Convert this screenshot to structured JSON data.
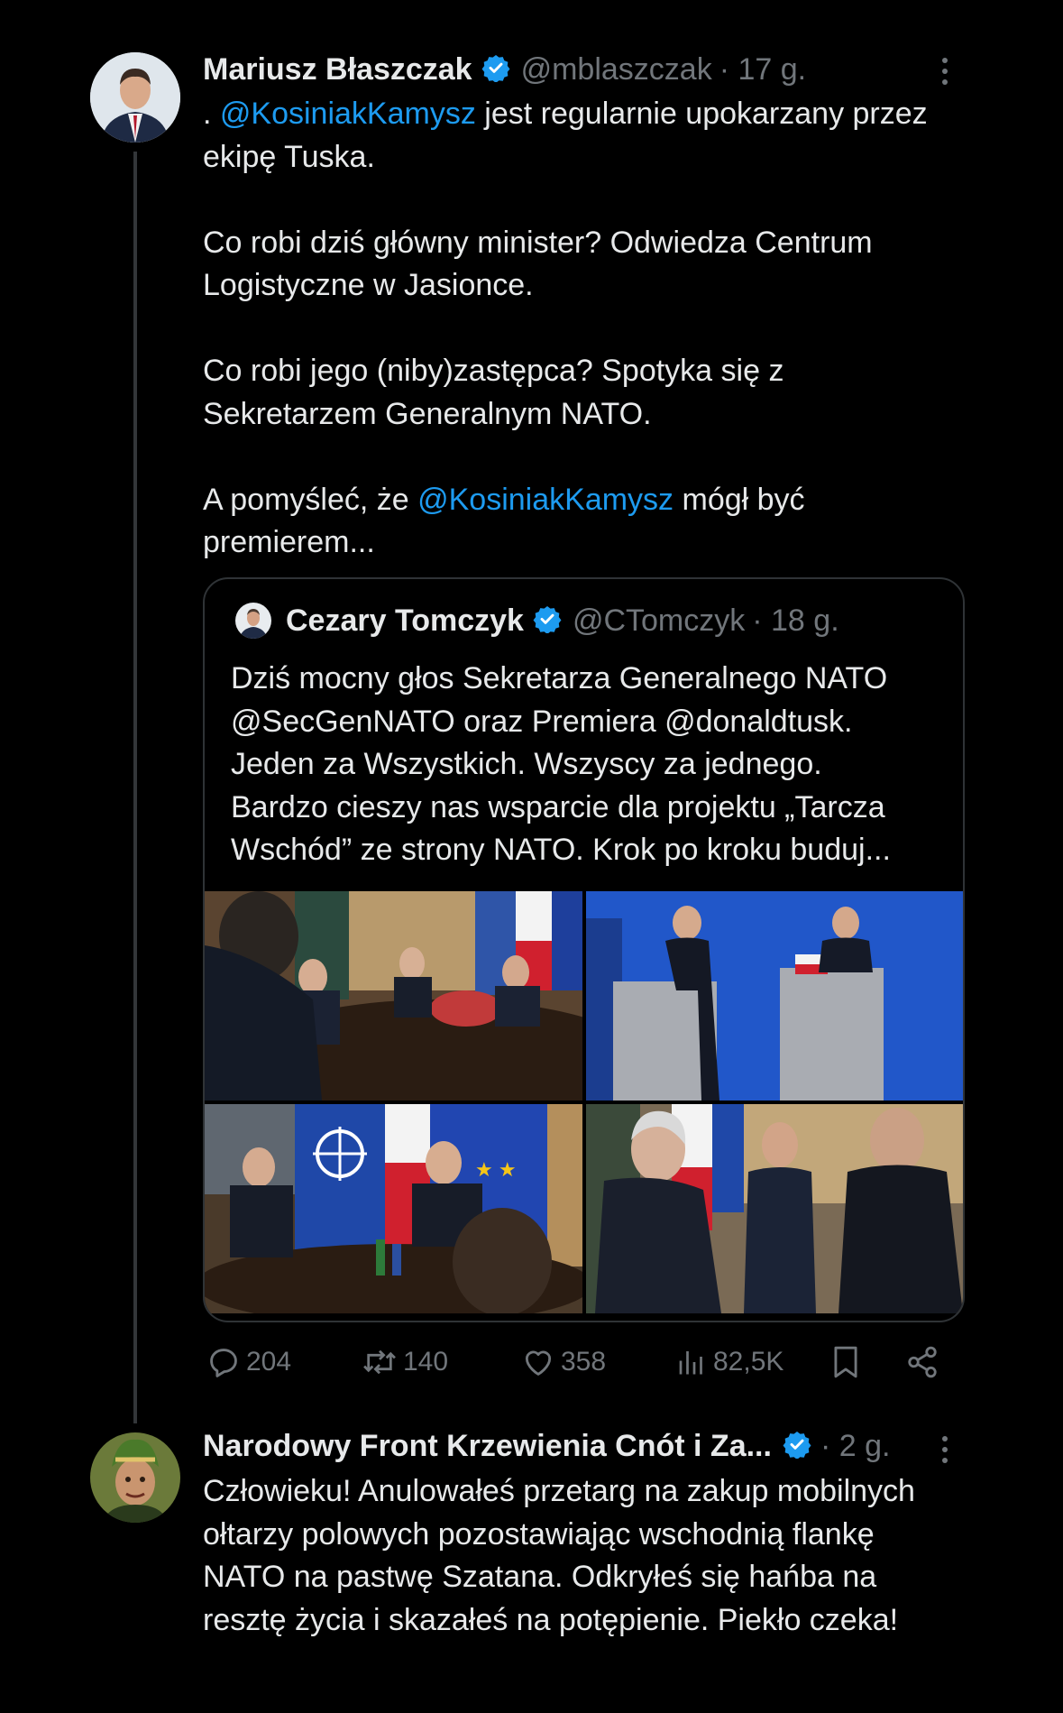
{
  "tweet": {
    "name": "Mariusz Błaszczak",
    "handle": "@mblaszczak",
    "time": "· 17 g.",
    "line1_prefix": ". ",
    "mention1": "@KosiniakKamysz",
    "line1_rest": " jest regularnie upokarzany przez",
    "line2": "ekipę Tuska.",
    "p2_line1": "Co robi dziś główny minister? Odwiedza Centrum",
    "p2_line2": "Logistyczne w Jasionce.",
    "p3_line1": "Co robi jego (niby)zastępca? Spotyka się z",
    "p3_line2": "Sekretarzem Generalnym NATO.",
    "p4_prefix": "A pomyśleć, że ",
    "mention2": "@KosiniakKamysz",
    "p4_rest": " mógł być",
    "p4_line2": "premierem..."
  },
  "quote": {
    "name": "Cezary Tomczyk",
    "handle": "@CTomczyk",
    "time": "· 18 g.",
    "lines": [
      "Dziś mocny głos Sekretarza Generalnego NATO",
      "@SecGenNATO oraz Premiera @donaldtusk.",
      "Jeden za Wszystkich. Wszyscy za jednego.",
      "Bardzo cieszy nas wsparcie dla projektu „Tarcza",
      "Wschód” ze strony NATO. Krok po kroku buduj..."
    ]
  },
  "actions": {
    "replies": "204",
    "reposts": "140",
    "likes": "358",
    "views": "82,5K"
  },
  "reply": {
    "name": "Narodowy Front Krzewienia Cnót i Za...",
    "time": "· 2 g.",
    "lines": [
      "Człowieku! Anulowałeś przetarg na zakup mobilnych",
      "ołtarzy polowych pozostawiając wschodnią flankę",
      "NATO na pastwę Szatana. Odkryłeś  się hańba na",
      "resztę życia i skazałeś na potępienie. Piekło czeka!"
    ]
  },
  "colors": {
    "background": "#000000",
    "text": "#e7e9ea",
    "secondary": "#71767b",
    "link": "#1d9bf0",
    "border": "#2f3336"
  }
}
